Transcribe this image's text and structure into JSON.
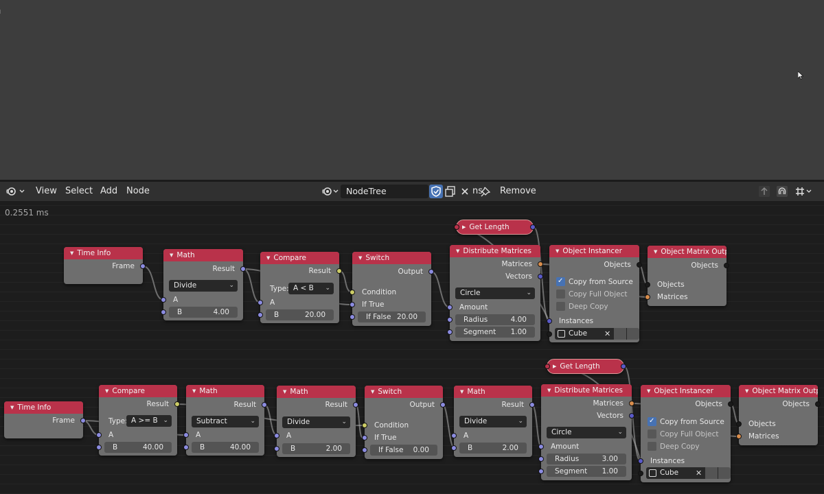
{
  "header": {
    "menu": [
      "View",
      "Select",
      "Add",
      "Node"
    ],
    "tree_name": "NodeTree",
    "truncated_label": "ns",
    "remove_label": "Remove"
  },
  "timing": "0.2551 ms",
  "colors": {
    "node_header": "#b9324a",
    "socket_float": "#8b8be0",
    "socket_bool": "#cccc66",
    "socket_object": "#1a1a1a",
    "socket_matrix": "#d98d4c",
    "socket_vector": "#5a5ac8",
    "checkbox_on": "#4772b3"
  },
  "row1": {
    "time_info": {
      "title": "Time Info",
      "frame": "Frame"
    },
    "math": {
      "title": "Math",
      "result": "Result",
      "op": "Divide",
      "a": "A",
      "b_label": "B",
      "b_val": "4.00"
    },
    "compare": {
      "title": "Compare",
      "result": "Result",
      "type_label": "Type:",
      "type_val": "A < B",
      "a": "A",
      "b_label": "B",
      "b_val": "20.00"
    },
    "switch": {
      "title": "Switch",
      "output": "Output",
      "condition": "Condition",
      "if_true": "If True",
      "if_false_label": "If False",
      "if_false_val": "20.00"
    },
    "get_length": {
      "title": "Get Length"
    },
    "distribute": {
      "title": "Distribute Matrices",
      "matrices": "Matrices",
      "vectors": "Vectors",
      "mode": "Circle",
      "amount": "Amount",
      "radius_label": "Radius",
      "radius_val": "4.00",
      "segment_label": "Segment",
      "segment_val": "1.00"
    },
    "instancer": {
      "title": "Object Instancer",
      "objects": "Objects",
      "copy_source": "Copy from Source",
      "copy_full": "Copy Full Object",
      "deep_copy": "Deep Copy",
      "instances": "Instances",
      "object": "Cube"
    },
    "matrix_out": {
      "title": "Object Matrix Outp..",
      "objects_out": "Objects",
      "objects_in": "Objects",
      "matrices": "Matrices"
    }
  },
  "row2": {
    "time_info": {
      "title": "Time Info",
      "frame": "Frame"
    },
    "compare": {
      "title": "Compare",
      "result": "Result",
      "type_label": "Type:",
      "type_val": "A >= B",
      "a": "A",
      "b_label": "B",
      "b_val": "40.00"
    },
    "math1": {
      "title": "Math",
      "result": "Result",
      "op": "Subtract",
      "a": "A",
      "b_label": "B",
      "b_val": "40.00"
    },
    "math2": {
      "title": "Math",
      "result": "Result",
      "op": "Divide",
      "a": "A",
      "b_label": "B",
      "b_val": "2.00"
    },
    "switch": {
      "title": "Switch",
      "output": "Output",
      "condition": "Condition",
      "if_true": "If True",
      "if_false_label": "If False",
      "if_false_val": "0.00"
    },
    "math3": {
      "title": "Math",
      "result": "Result",
      "op": "Divide",
      "a": "A",
      "b_label": "B",
      "b_val": "2.00"
    },
    "get_length": {
      "title": "Get Length"
    },
    "distribute": {
      "title": "Distribute Matrices",
      "matrices": "Matrices",
      "vectors": "Vectors",
      "mode": "Circle",
      "amount": "Amount",
      "radius_label": "Radius",
      "radius_val": "3.00",
      "segment_label": "Segment",
      "segment_val": "1.00"
    },
    "instancer": {
      "title": "Object Instancer",
      "objects": "Objects",
      "copy_source": "Copy from Source",
      "copy_full": "Copy Full Object",
      "deep_copy": "Deep Copy",
      "instances": "Instances",
      "object": "Cube"
    },
    "matrix_out": {
      "title": "Object Matrix Outp..",
      "objects_out": "Objects",
      "objects_in": "Objects",
      "matrices": "Matrices"
    }
  }
}
